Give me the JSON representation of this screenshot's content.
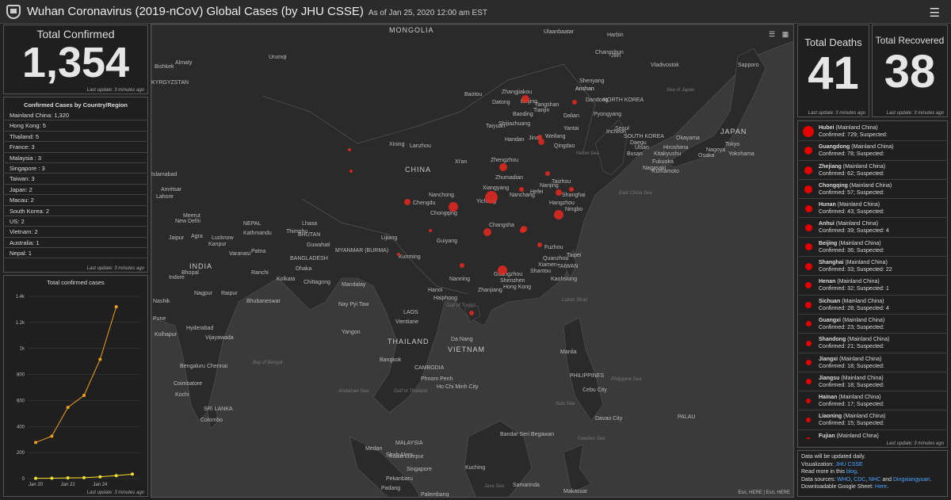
{
  "header": {
    "title": "Wuhan Coronavirus (2019-nCoV) Global Cases (by JHU CSSE)",
    "subtitle": "As of Jan 25, 2020 12:00 am EST"
  },
  "confirmed": {
    "label": "Total Confirmed",
    "value": "1,354",
    "last_update": "Last update: 3 minutes ago"
  },
  "deaths": {
    "label": "Total Deaths",
    "value": "41",
    "last_update": "Last update: 3 minutes ago"
  },
  "recovered": {
    "label": "Total Recovered",
    "value": "38",
    "last_update": "Last update: 3 minutes ago"
  },
  "countries": {
    "title": "Confirmed Cases by Country/Region",
    "last_update": "Last update: 3 minutes ago",
    "items": [
      "Mainland China:  1,320",
      "Hong Kong:  5",
      "Thailand:  5",
      "France:  3",
      "Malaysia :  3",
      "Singapore :  3",
      "Taiwan:  3",
      "Japan:  2",
      "Macau:  2",
      "South Korea:  2",
      "US:  2",
      "Vietnam:  2",
      "Australia:  1",
      "Nepal:  1"
    ]
  },
  "chart": {
    "title": "Total confirmed cases",
    "last_update": "Last update: 3 minutes ago"
  },
  "chart_data": {
    "type": "line",
    "title": "Total confirmed cases",
    "yticks": [
      "0",
      "200",
      "400",
      "600",
      "800",
      "1k",
      "1.2k",
      "1.4k"
    ],
    "xticks": [
      "Jan 20",
      "Jan 22",
      "Jan 24"
    ],
    "x": [
      "Jan 20",
      "Jan 21",
      "Jan 22",
      "Jan 23",
      "Jan 24",
      "Jan 25",
      "Jan 26"
    ],
    "ylim": [
      0,
      1400
    ],
    "series": [
      {
        "values": [
          278,
          326,
          547,
          639,
          916,
          1320,
          null
        ],
        "color": "#f0a020"
      },
      {
        "values": [
          2,
          3,
          5,
          7,
          14,
          23,
          34
        ],
        "color": "#f5e030"
      }
    ]
  },
  "provinces": {
    "last_update": "Last update: 3 minutes ago",
    "suffix": "(Mainland China)",
    "items": [
      {
        "name": "Hubei",
        "confirmed": "Confirmed: 729; Suspected:",
        "size": 14
      },
      {
        "name": "Guangdong",
        "confirmed": "Confirmed: 78; Suspected:",
        "size": 10
      },
      {
        "name": "Zhejiang",
        "confirmed": "Confirmed: 62; Suspected:",
        "size": 10
      },
      {
        "name": "Chongqing",
        "confirmed": "Confirmed: 57; Suspected:",
        "size": 10
      },
      {
        "name": "Hunan",
        "confirmed": "Confirmed: 43; Suspected:",
        "size": 9
      },
      {
        "name": "Anhui",
        "confirmed": "Confirmed: 39; Suspected: 4",
        "size": 9
      },
      {
        "name": "Beijing",
        "confirmed": "Confirmed: 36; Suspected:",
        "size": 9
      },
      {
        "name": "Shanghai",
        "confirmed": "Confirmed: 33; Suspected: 22",
        "size": 9
      },
      {
        "name": "Henan",
        "confirmed": "Confirmed: 32; Suspected: 1",
        "size": 8
      },
      {
        "name": "Sichuan",
        "confirmed": "Confirmed: 28; Suspected: 4",
        "size": 8
      },
      {
        "name": "Guangxi",
        "confirmed": "Confirmed: 23; Suspected:",
        "size": 7
      },
      {
        "name": "Shandong",
        "confirmed": "Confirmed: 21; Suspected:",
        "size": 7
      },
      {
        "name": "Jiangxi",
        "confirmed": "Confirmed: 18; Suspected:",
        "size": 7
      },
      {
        "name": "Jiangsu",
        "confirmed": "Confirmed: 18; Suspected:",
        "size": 7
      },
      {
        "name": "Hainan",
        "confirmed": "Confirmed: 17; Suspected:",
        "size": 6
      },
      {
        "name": "Liaoning",
        "confirmed": "Confirmed: 15; Suspected:",
        "size": 6
      },
      {
        "name": "Fujian",
        "confirmed": "",
        "size": 6
      }
    ]
  },
  "info": {
    "line1": "Data will be updated daily.",
    "line2_prefix": "Visualization: ",
    "line2_link": "JHU CSSE",
    "line3_prefix": "Read more in this ",
    "line3_link": "blog",
    "line4_prefix": "Data sources: ",
    "src1": "WHO",
    "src2": "CDC",
    "src3": "NHC",
    "and": " and ",
    "src4": "Dingxiangyuan",
    "line5_prefix": "Downloadable Google Sheet: ",
    "line5_link": "Here"
  },
  "map": {
    "attribution": "Esri, HERE | Esri, HERE",
    "labels": [
      {
        "t": "MONGOLIA",
        "c": "big"
      },
      {
        "t": "CHINA",
        "c": "big"
      },
      {
        "t": "INDIA",
        "c": "big"
      },
      {
        "t": "MYANMAR (BURMA)"
      },
      {
        "t": "NEPAL"
      },
      {
        "t": "BHUTAN"
      },
      {
        "t": "BANGLADESH"
      },
      {
        "t": "LAOS"
      },
      {
        "t": "THAILAND",
        "c": "big"
      },
      {
        "t": "VIETNAM",
        "c": "big"
      },
      {
        "t": "CAMBODIA"
      },
      {
        "t": "MALAYSIA"
      },
      {
        "t": "SOUTH KOREA"
      },
      {
        "t": "NORTH KOREA"
      },
      {
        "t": "JAPAN",
        "c": "big"
      },
      {
        "t": "TAIWAN"
      },
      {
        "t": "PHILIPPINES"
      },
      {
        "t": "SRI LANKA"
      },
      {
        "t": "Bay of Bengal",
        "c": "sea"
      },
      {
        "t": "Andaman Sea",
        "c": "sea"
      },
      {
        "t": "Yellow Sea",
        "c": "sea"
      },
      {
        "t": "Gulf of Tonkin",
        "c": "sea"
      },
      {
        "t": "Sulu Sea",
        "c": "sea"
      },
      {
        "t": "Philippine Sea",
        "c": "sea"
      },
      {
        "t": "Java Sea",
        "c": "sea"
      },
      {
        "t": "Celebes Sea",
        "c": "sea"
      },
      {
        "t": "Gulf of Thailand",
        "c": "sea"
      },
      {
        "t": "Luzon Strait",
        "c": "sea"
      },
      {
        "t": "East China Sea",
        "c": "sea"
      },
      {
        "t": "Sea of Japan",
        "c": "sea"
      },
      {
        "t": "Ulaanbaatar"
      },
      {
        "t": "Beijing"
      },
      {
        "t": "Tianjin"
      },
      {
        "t": "Shenyang"
      },
      {
        "t": "Anshan"
      },
      {
        "t": "Dalian"
      },
      {
        "t": "Pyongyang"
      },
      {
        "t": "Seoul"
      },
      {
        "t": "Busan"
      },
      {
        "t": "Ulsan"
      },
      {
        "t": "Fukuoka"
      },
      {
        "t": "Osaka"
      },
      {
        "t": "Nagoya"
      },
      {
        "t": "Tokyo"
      },
      {
        "t": "Yokohama"
      },
      {
        "t": "Sapporo"
      },
      {
        "t": "Vladivostok"
      },
      {
        "t": "Harbin"
      },
      {
        "t": "Changchun"
      },
      {
        "t": "Jilin"
      },
      {
        "t": "Baotou"
      },
      {
        "t": "Datong"
      },
      {
        "t": "Zhangjiakou"
      },
      {
        "t": "Tangshan"
      },
      {
        "t": "Baoding"
      },
      {
        "t": "Shijiazhuang"
      },
      {
        "t": "Taiyuan"
      },
      {
        "t": "Jinan"
      },
      {
        "t": "Weifang"
      },
      {
        "t": "Qingdao"
      },
      {
        "t": "Yantai"
      },
      {
        "t": "Handan"
      },
      {
        "t": "Zhengzhou"
      },
      {
        "t": "Xi'an"
      },
      {
        "t": "Lanzhou"
      },
      {
        "t": "Xining"
      },
      {
        "t": "Zhumadian"
      },
      {
        "t": "Hefei"
      },
      {
        "t": "Nanjing"
      },
      {
        "t": "Taizhou"
      },
      {
        "t": "Shanghai"
      },
      {
        "t": "Hangzhou"
      },
      {
        "t": "Ningbo"
      },
      {
        "t": "Xiangyang"
      },
      {
        "t": "Yichang"
      },
      {
        "t": "Nanchong"
      },
      {
        "t": "Chengdu"
      },
      {
        "t": "Chongqing"
      },
      {
        "t": "Changsha"
      },
      {
        "t": "Nanchang"
      },
      {
        "t": "Fuzhou"
      },
      {
        "t": "Quanzhou"
      },
      {
        "t": "Xiamen"
      },
      {
        "t": "Taipei"
      },
      {
        "t": "Kaohsiung"
      },
      {
        "t": "Shantou"
      },
      {
        "t": "Guangzhou"
      },
      {
        "t": "Shenzhen"
      },
      {
        "t": "Hong Kong"
      },
      {
        "t": "Zhanjiang"
      },
      {
        "t": "Nanning"
      },
      {
        "t": "Guiyang"
      },
      {
        "t": "Kunming"
      },
      {
        "t": "Lijiang"
      },
      {
        "t": "Lhasa"
      },
      {
        "t": "Hanoi"
      },
      {
        "t": "Haiphong"
      },
      {
        "t": "Vientiane"
      },
      {
        "t": "Da Nang"
      },
      {
        "t": "Bangkok"
      },
      {
        "t": "Phnom Penh"
      },
      {
        "t": "Ho Chi Minh City"
      },
      {
        "t": "Yangon"
      },
      {
        "t": "Mandalay"
      },
      {
        "t": "Nay Pyi Taw"
      },
      {
        "t": "Chittagong"
      },
      {
        "t": "Dhaka"
      },
      {
        "t": "Kolkata"
      },
      {
        "t": "Guwahati"
      },
      {
        "t": "Thimphu"
      },
      {
        "t": "Kathmandu"
      },
      {
        "t": "Patna"
      },
      {
        "t": "Varanasi"
      },
      {
        "t": "Lucknow"
      },
      {
        "t": "Kanpur"
      },
      {
        "t": "Agra"
      },
      {
        "t": "New Delhi"
      },
      {
        "t": "Jaipur"
      },
      {
        "t": "Meerut"
      },
      {
        "t": "Amritsar"
      },
      {
        "t": "Lahore"
      },
      {
        "t": "Islamabad"
      },
      {
        "t": "Bishkek"
      },
      {
        "t": "Almaty"
      },
      {
        "t": "KYRGYZSTAN"
      },
      {
        "t": "Urumqi"
      },
      {
        "t": "Indore"
      },
      {
        "t": "Bhopal"
      },
      {
        "t": "Nagpur"
      },
      {
        "t": "Raipur"
      },
      {
        "t": "Ranchi"
      },
      {
        "t": "Bhubaneswar"
      },
      {
        "t": "Hyderabad"
      },
      {
        "t": "Vijayawada"
      },
      {
        "t": "Nashik"
      },
      {
        "t": "Pune"
      },
      {
        "t": "Kolhapur"
      },
      {
        "t": "Bengaluru"
      },
      {
        "t": "Chennai"
      },
      {
        "t": "Coimbatore"
      },
      {
        "t": "Kochi"
      },
      {
        "t": "Colombo"
      },
      {
        "t": "Medan"
      },
      {
        "t": "Kuala Lumpur"
      },
      {
        "t": "Shah Alam"
      },
      {
        "t": "Singapore"
      },
      {
        "t": "Kuching"
      },
      {
        "t": "Bandar Seri Begawan"
      },
      {
        "t": "Samarinda"
      },
      {
        "t": "Manila"
      },
      {
        "t": "Cebu City"
      },
      {
        "t": "Davao City"
      },
      {
        "t": "Makassar"
      },
      {
        "t": "Palembang"
      },
      {
        "t": "Padang"
      },
      {
        "t": "Pekanbaru"
      },
      {
        "t": "PALAU"
      },
      {
        "t": "Okayama"
      },
      {
        "t": "Hiroshima"
      },
      {
        "t": "Kitakyushu"
      },
      {
        "t": "Nagasaki"
      },
      {
        "t": "Kumamoto"
      },
      {
        "t": "Incheon"
      },
      {
        "t": "Daegu"
      },
      {
        "t": "Dandong"
      },
      {
        "t": "Anshan"
      }
    ]
  }
}
